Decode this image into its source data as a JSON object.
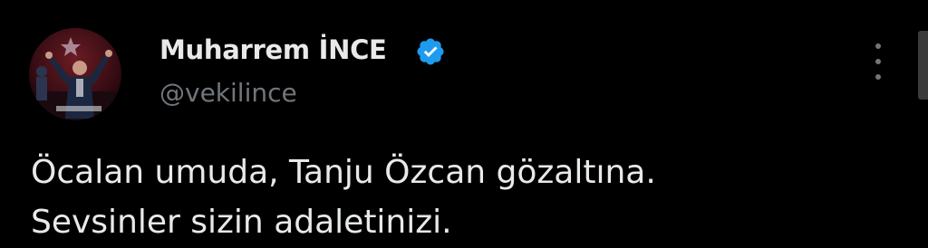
{
  "author": {
    "display_name": "Muharrem İNCE",
    "handle": "@vekilince",
    "verified": true,
    "avatar_icon": "profile-photo",
    "verified_icon": "verified-badge-icon"
  },
  "tweet": {
    "lines": [
      "Öcalan umuda, Tanju Özcan gözaltına.",
      "Sevsinler sizin adaletinizi."
    ]
  },
  "menu": {
    "icon": "more-options-icon"
  },
  "colors": {
    "background": "#000000",
    "text_primary": "#e7e9ea",
    "text_secondary": "#71767b",
    "verified_blue": "#1d9bf0"
  }
}
